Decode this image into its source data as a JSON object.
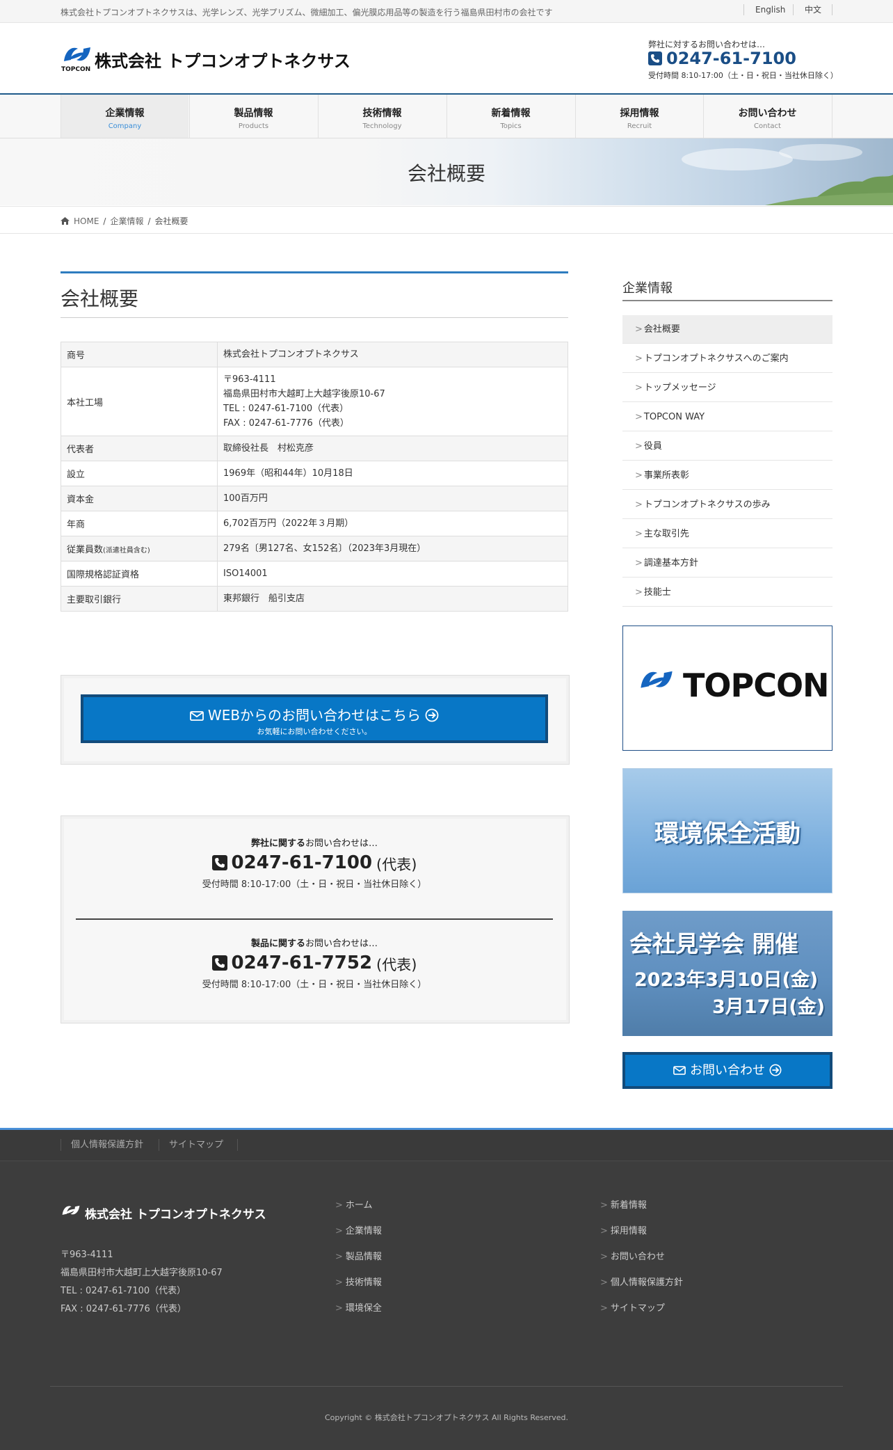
{
  "topbar": {
    "tagline": "株式会社トプコンオプトネクサスは、光学レンズ、光学プリズム、微細加工、偏光膜応用品等の製造を行う福島県田村市の会社です",
    "lang_en": "English",
    "lang_zh": "中文"
  },
  "header": {
    "logo_text": "株式会社 トプコンオプトネクサス",
    "logo_brand": "TOPCON",
    "contact_label": "弊社に対するお問い合わせは…",
    "phone": "0247-61-7100",
    "hours": "受付時間 8:10-17:00（土・日・祝日・当社休日除く）"
  },
  "nav": [
    {
      "jp": "企業情報",
      "en": "Company"
    },
    {
      "jp": "製品情報",
      "en": "Products"
    },
    {
      "jp": "技術情報",
      "en": "Technology"
    },
    {
      "jp": "新着情報",
      "en": "Topics"
    },
    {
      "jp": "採用情報",
      "en": "Recruit"
    },
    {
      "jp": "お問い合わせ",
      "en": "Contact"
    }
  ],
  "banner": {
    "title": "会社概要"
  },
  "breadcrumb": {
    "home": "HOME",
    "section": "企業情報",
    "current": "会社概要"
  },
  "main": {
    "title": "会社概要",
    "table": [
      {
        "k": "商号",
        "v": "株式会社トプコンオプトネクサス"
      },
      {
        "k": "本社工場",
        "v1": "〒963-4111",
        "v2": "福島県田村市大越町上大越字後原10-67",
        "v3": "TEL : 0247-61-7100（代表）",
        "v4": "FAX : 0247-61-7776（代表）"
      },
      {
        "k": "代表者",
        "v": "取締役社長　村松克彦"
      },
      {
        "k": "設立",
        "v": "1969年（昭和44年）10月18日"
      },
      {
        "k": "資本金",
        "v": "100百万円"
      },
      {
        "k": "年商",
        "v": "6,702百万円（2022年３月期）"
      },
      {
        "k": "従業員数",
        "k_small": "(派遣社員含む)",
        "v": "279名〔男127名、女152名〕（2023年3月現在）"
      },
      {
        "k": "国際規格認証資格",
        "v": "ISO14001"
      },
      {
        "k": "主要取引銀行",
        "v": "東邦銀行　船引支店"
      }
    ],
    "cta": {
      "label": "WEBからのお問い合わせはこちら",
      "sub": "お気軽にお問い合わせください。"
    },
    "contact1": {
      "bold": "弊社に関する",
      "label": "お問い合わせは…",
      "phone": "0247-61-7100",
      "suffix": "(代表)",
      "hours": "受付時間 8:10-17:00（土・日・祝日・当社休日除く）"
    },
    "contact2": {
      "bold": "製品に関する",
      "label": "お問い合わせは…",
      "phone": "0247-61-7752",
      "suffix": "(代表)",
      "hours": "受付時間 8:10-17:00（土・日・祝日・当社休日除く）"
    }
  },
  "sidebar": {
    "title": "企業情報",
    "items": [
      "会社概要",
      "トプコンオプトネクサスへのご案内",
      "トップメッセージ",
      "TOPCON WAY",
      "役員",
      "事業所表彰",
      "トプコンオプトネクサスの歩み",
      "主な取引先",
      "調達基本方針",
      "技能士"
    ],
    "topcon_banner": "TOPCON",
    "env_banner": "環境保全活動",
    "tour_line1": "会社見学会 開催",
    "tour_line2": "2023年3月10日(金)",
    "tour_line3": "3月17日(金)",
    "contact_button": "お問い合わせ"
  },
  "footer": {
    "nav": [
      "個人情報保護方針",
      "サイトマップ"
    ],
    "logo_text": "株式会社 トプコンオプトネクサス",
    "postal": "〒963-4111",
    "address": "福島県田村市大越町上大越字後原10-67",
    "tel": "TEL : 0247-61-7100（代表）",
    "fax": "FAX : 0247-61-7776（代表）",
    "col1": [
      "ホーム",
      "企業情報",
      "製品情報",
      "技術情報",
      "環境保全"
    ],
    "col2": [
      "新着情報",
      "採用情報",
      "お問い合わせ",
      "個人情報保護方針",
      "サイトマップ"
    ],
    "copyright": "Copyright © 株式会社トプコンオプトネクサス All Rights Reserved."
  },
  "colors": {
    "accent": "#0877c6",
    "navy": "#1a4e86",
    "footer_bg": "#3d3d3d"
  }
}
